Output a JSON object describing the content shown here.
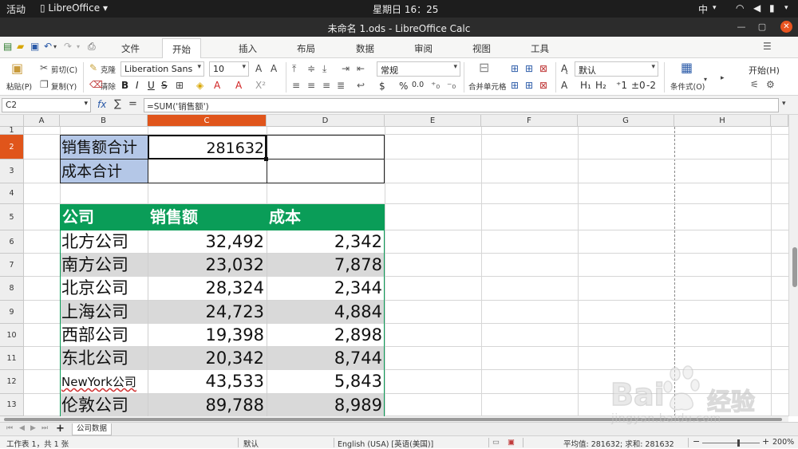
{
  "topbar": {
    "activities": "活动",
    "app": "LibreOffice",
    "clock": "星期日 16：25",
    "input_method": "中"
  },
  "window": {
    "title": "未命名 1.ods - LibreOffice Calc"
  },
  "tabs": [
    "文件",
    "开始",
    "插入",
    "布局",
    "数据",
    "审阅",
    "视图",
    "工具"
  ],
  "active_tab": "开始",
  "toolbar": {
    "paste": "粘贴(P)",
    "cut": "剪切(C)",
    "copy": "复制(Y)",
    "clone": "克隆",
    "clear": "清除",
    "font_name": "Liberation Sans",
    "font_size": "10",
    "number_format": "常规",
    "merge": "合并单元格",
    "cell_style": "默认",
    "conditional": "条件式(O)",
    "start_menu": "开始(H)",
    "currency": "$",
    "percent": "%",
    "decimal_zero": "0.0"
  },
  "formula_bar": {
    "name_box": "C2",
    "formula": "=SUM('销售额')",
    "fx": "fx",
    "sigma": "∑",
    "equals": "="
  },
  "columns": [
    "A",
    "B",
    "C",
    "D",
    "E",
    "F",
    "G",
    "H"
  ],
  "selected_column": "C",
  "rows": [
    "1",
    "2",
    "3",
    "4",
    "5",
    "6",
    "7",
    "8",
    "9",
    "10",
    "11",
    "12",
    "13"
  ],
  "selected_row": "2",
  "summary": {
    "sales_total_label": "销售额合计",
    "sales_total_value": "281632",
    "cost_total_label": "成本合计"
  },
  "table": {
    "headers": [
      "公司",
      "销售额",
      "成本"
    ],
    "rows": [
      [
        "北方公司",
        "32,492",
        "2,342"
      ],
      [
        "南方公司",
        "23,032",
        "7,878"
      ],
      [
        "北京公司",
        "28,324",
        "2,344"
      ],
      [
        "上海公司",
        "24,723",
        "4,884"
      ],
      [
        "西部公司",
        "19,398",
        "2,898"
      ],
      [
        "东北公司",
        "20,342",
        "8,744"
      ],
      [
        "NewYork公司",
        "43,533",
        "5,843"
      ],
      [
        "伦敦公司",
        "89,788",
        "8,989"
      ]
    ]
  },
  "sheet_tab": "公司数据",
  "status": {
    "sheet_info": "工作表 1，共 1 张",
    "page_style": "默认",
    "language": "English (USA) [英语(美国)]",
    "stats": "平均值: 281632; 求和: 281632",
    "zoom": "200%"
  },
  "watermark": {
    "brand": "Bai",
    "brand2": "经验",
    "url": "jingyan.baidu.com"
  },
  "colors": {
    "header_green": "#0a9d58",
    "label_blue": "#b4c7e7",
    "row_gray": "#d9d9d9",
    "accent": "#e0551b"
  }
}
